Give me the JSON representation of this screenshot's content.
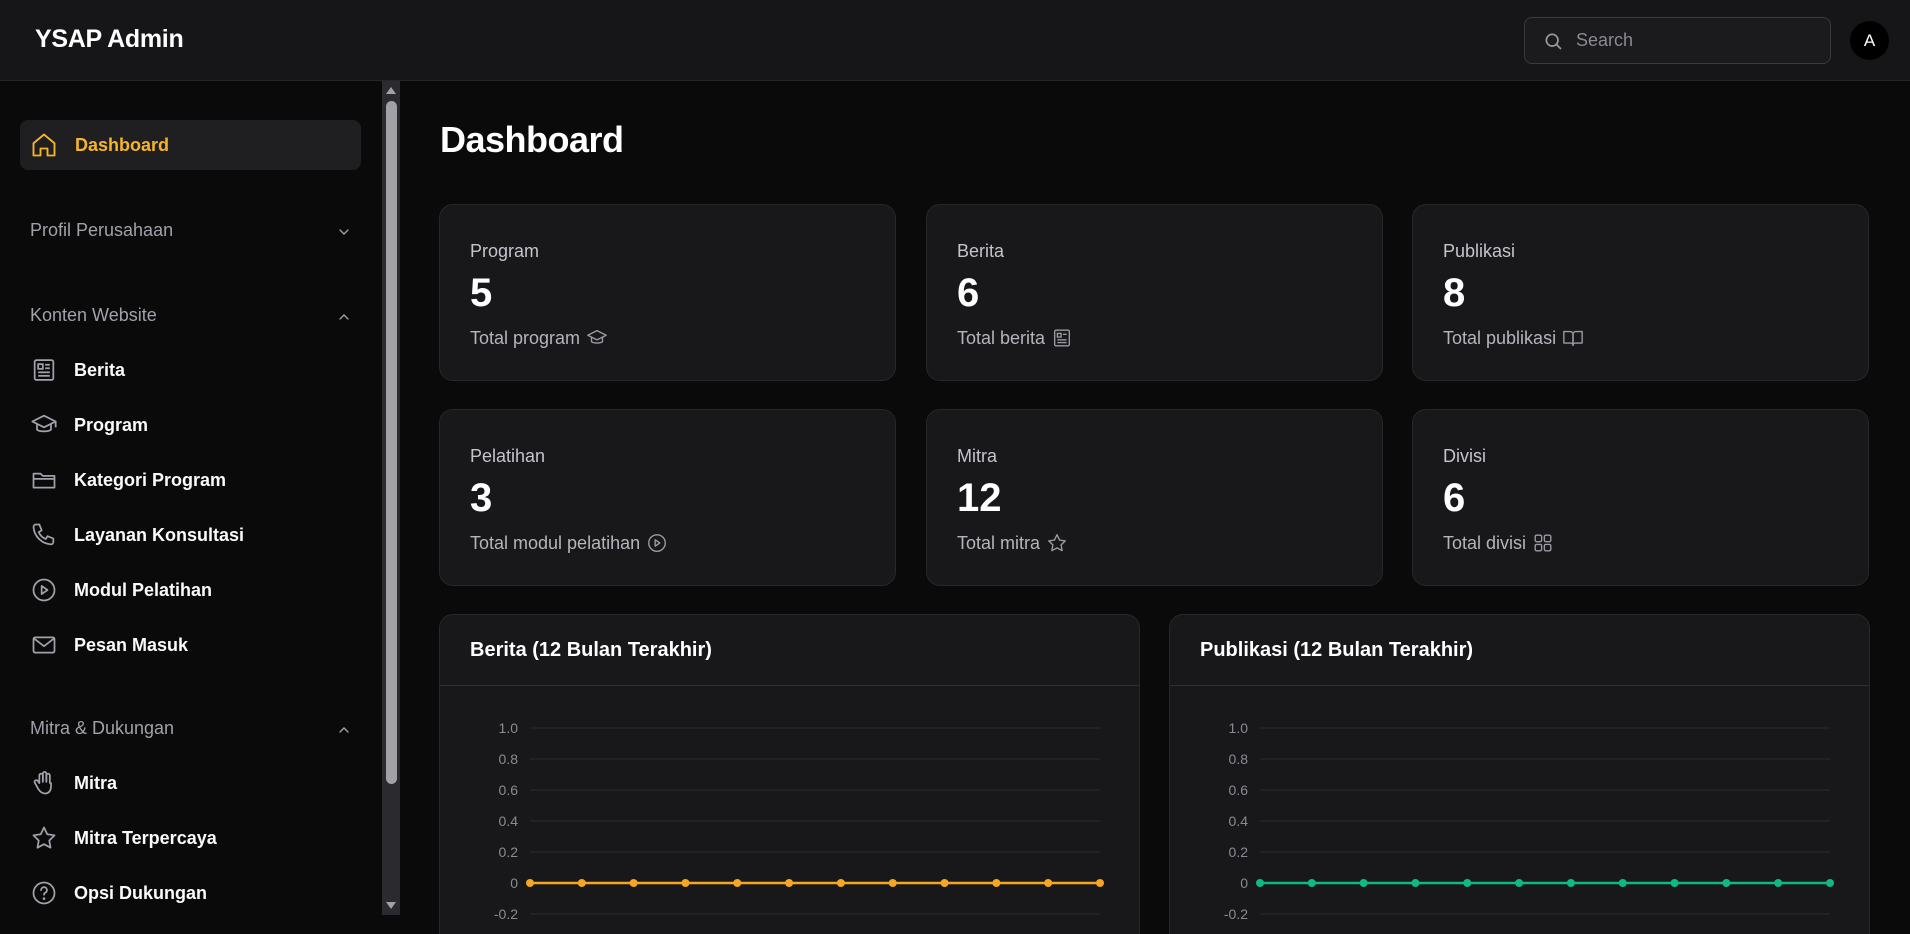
{
  "header": {
    "brand": "YSAP Admin",
    "search_placeholder": "Search",
    "avatar_initial": "A"
  },
  "sidebar": {
    "active": {
      "label": "Dashboard",
      "icon": "home-icon"
    },
    "groups": [
      {
        "label": "Profil Perusahaan",
        "expanded": false,
        "items": []
      },
      {
        "label": "Konten Website",
        "expanded": true,
        "items": [
          {
            "label": "Berita",
            "icon": "newspaper-icon"
          },
          {
            "label": "Program",
            "icon": "graduation-cap-icon"
          },
          {
            "label": "Kategori Program",
            "icon": "folder-icon"
          },
          {
            "label": "Layanan Konsultasi",
            "icon": "phone-icon"
          },
          {
            "label": "Modul Pelatihan",
            "icon": "play-circle-icon"
          },
          {
            "label": "Pesan Masuk",
            "icon": "mail-icon"
          }
        ]
      },
      {
        "label": "Mitra & Dukungan",
        "expanded": true,
        "items": [
          {
            "label": "Mitra",
            "icon": "hand-icon"
          },
          {
            "label": "Mitra Terpercaya",
            "icon": "star-icon"
          },
          {
            "label": "Opsi Dukungan",
            "icon": "help-circle-icon"
          }
        ]
      }
    ]
  },
  "main": {
    "title": "Dashboard",
    "cards": [
      {
        "title": "Program",
        "value": "5",
        "subtitle": "Total program",
        "icon": "graduation-cap-icon"
      },
      {
        "title": "Berita",
        "value": "6",
        "subtitle": "Total berita",
        "icon": "newspaper-icon"
      },
      {
        "title": "Publikasi",
        "value": "8",
        "subtitle": "Total publikasi",
        "icon": "book-open-icon"
      },
      {
        "title": "Pelatihan",
        "value": "3",
        "subtitle": "Total modul pelatihan",
        "icon": "play-circle-icon"
      },
      {
        "title": "Mitra",
        "value": "12",
        "subtitle": "Total mitra",
        "icon": "star-icon"
      },
      {
        "title": "Divisi",
        "value": "6",
        "subtitle": "Total divisi",
        "icon": "grid-icon"
      }
    ]
  },
  "chart_data": [
    {
      "type": "line",
      "title": "Berita (12 Bulan Terakhir)",
      "color": "#f5a623",
      "yticks": [
        "1.0",
        "0.8",
        "0.6",
        "0.4",
        "0.2",
        "0",
        "-0.2"
      ],
      "ylim": [
        -0.2,
        1.0
      ],
      "grid": true,
      "series": [
        {
          "values": [
            0,
            0,
            0,
            0,
            0,
            0,
            0,
            0,
            0,
            0,
            0,
            0
          ]
        }
      ]
    },
    {
      "type": "line",
      "title": "Publikasi (12 Bulan Terakhir)",
      "color": "#10b981",
      "yticks": [
        "1.0",
        "0.8",
        "0.6",
        "0.4",
        "0.2",
        "0",
        "-0.2"
      ],
      "ylim": [
        -0.2,
        1.0
      ],
      "grid": true,
      "series": [
        {
          "values": [
            0,
            0,
            0,
            0,
            0,
            0,
            0,
            0,
            0,
            0,
            0,
            0
          ]
        }
      ]
    }
  ]
}
